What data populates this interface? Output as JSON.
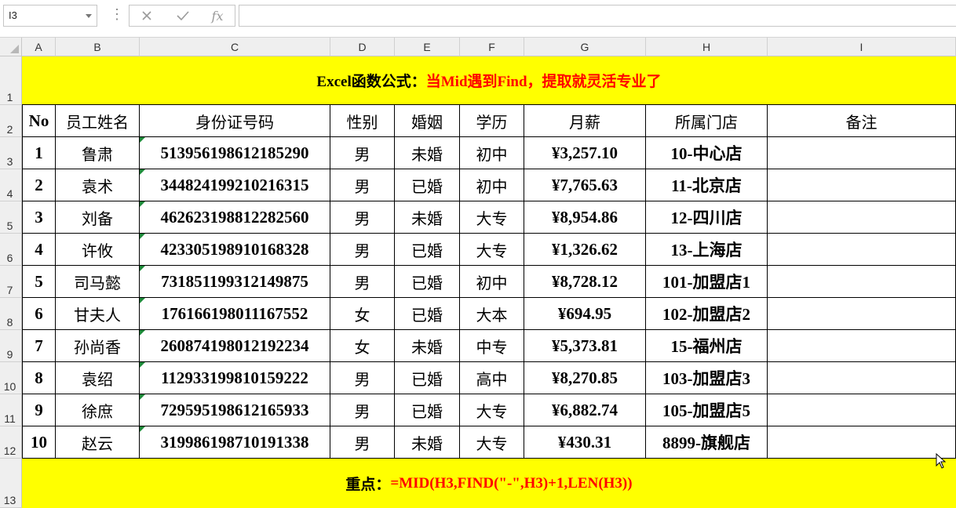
{
  "name_box": {
    "value": "I3"
  },
  "formula_bar": {
    "value": ""
  },
  "icons": {
    "cancel": "close-icon",
    "enter": "check-icon",
    "function": "fx-icon"
  },
  "columns": [
    "A",
    "B",
    "C",
    "D",
    "E",
    "F",
    "G",
    "H",
    "I"
  ],
  "rows": [
    "1",
    "2",
    "3",
    "4",
    "5",
    "6",
    "7",
    "8",
    "9",
    "10",
    "11",
    "12",
    "13"
  ],
  "title": {
    "black": "Excel函数公式：",
    "red": "当Mid遇到Find，提取就灵活专业了"
  },
  "headers": [
    "No",
    "员工姓名",
    "身份证号码",
    "性别",
    "婚姻",
    "学历",
    "月薪",
    "所属门店",
    "备注"
  ],
  "records": [
    [
      "1",
      "鲁肃",
      "513956198612185290",
      "男",
      "未婚",
      "初中",
      "¥3,257.10",
      "10-中心店",
      ""
    ],
    [
      "2",
      "袁术",
      "344824199210216315",
      "男",
      "已婚",
      "初中",
      "¥7,765.63",
      "11-北京店",
      ""
    ],
    [
      "3",
      "刘备",
      "462623198812282560",
      "男",
      "未婚",
      "大专",
      "¥8,954.86",
      "12-四川店",
      ""
    ],
    [
      "4",
      "许攸",
      "423305198910168328",
      "男",
      "已婚",
      "大专",
      "¥1,326.62",
      "13-上海店",
      ""
    ],
    [
      "5",
      "司马懿",
      "731851199312149875",
      "男",
      "已婚",
      "初中",
      "¥8,728.12",
      "101-加盟店1",
      ""
    ],
    [
      "6",
      "甘夫人",
      "176166198011167552",
      "女",
      "已婚",
      "大本",
      "¥694.95",
      "102-加盟店2",
      ""
    ],
    [
      "7",
      "孙尚香",
      "260874198012192234",
      "女",
      "未婚",
      "中专",
      "¥5,373.81",
      "15-福州店",
      ""
    ],
    [
      "8",
      "袁绍",
      "112933199810159222",
      "男",
      "已婚",
      "高中",
      "¥8,270.85",
      "103-加盟店3",
      ""
    ],
    [
      "9",
      "徐庶",
      "729595198612165933",
      "男",
      "已婚",
      "大专",
      "¥6,882.74",
      "105-加盟店5",
      ""
    ],
    [
      "10",
      "赵云",
      "319986198710191338",
      "男",
      "未婚",
      "大专",
      "¥430.31",
      "8899-旗舰店",
      ""
    ]
  ],
  "footer": {
    "black": "重点：",
    "red": "=MID(H3,FIND(\"-\",H3)+1,LEN(H3))"
  },
  "colors": {
    "banner": "#ffff00",
    "accent_red": "#ff0000",
    "text_green_marker": "#1e8a3a",
    "header_bg": "#efefef"
  }
}
